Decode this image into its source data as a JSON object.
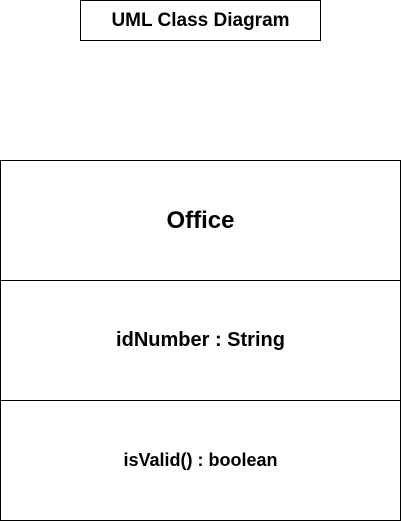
{
  "diagram": {
    "title": "UML Class Diagram"
  },
  "class": {
    "name": "Office",
    "attributes": [
      "idNumber : String"
    ],
    "operations": [
      "isValid() : boolean"
    ]
  }
}
